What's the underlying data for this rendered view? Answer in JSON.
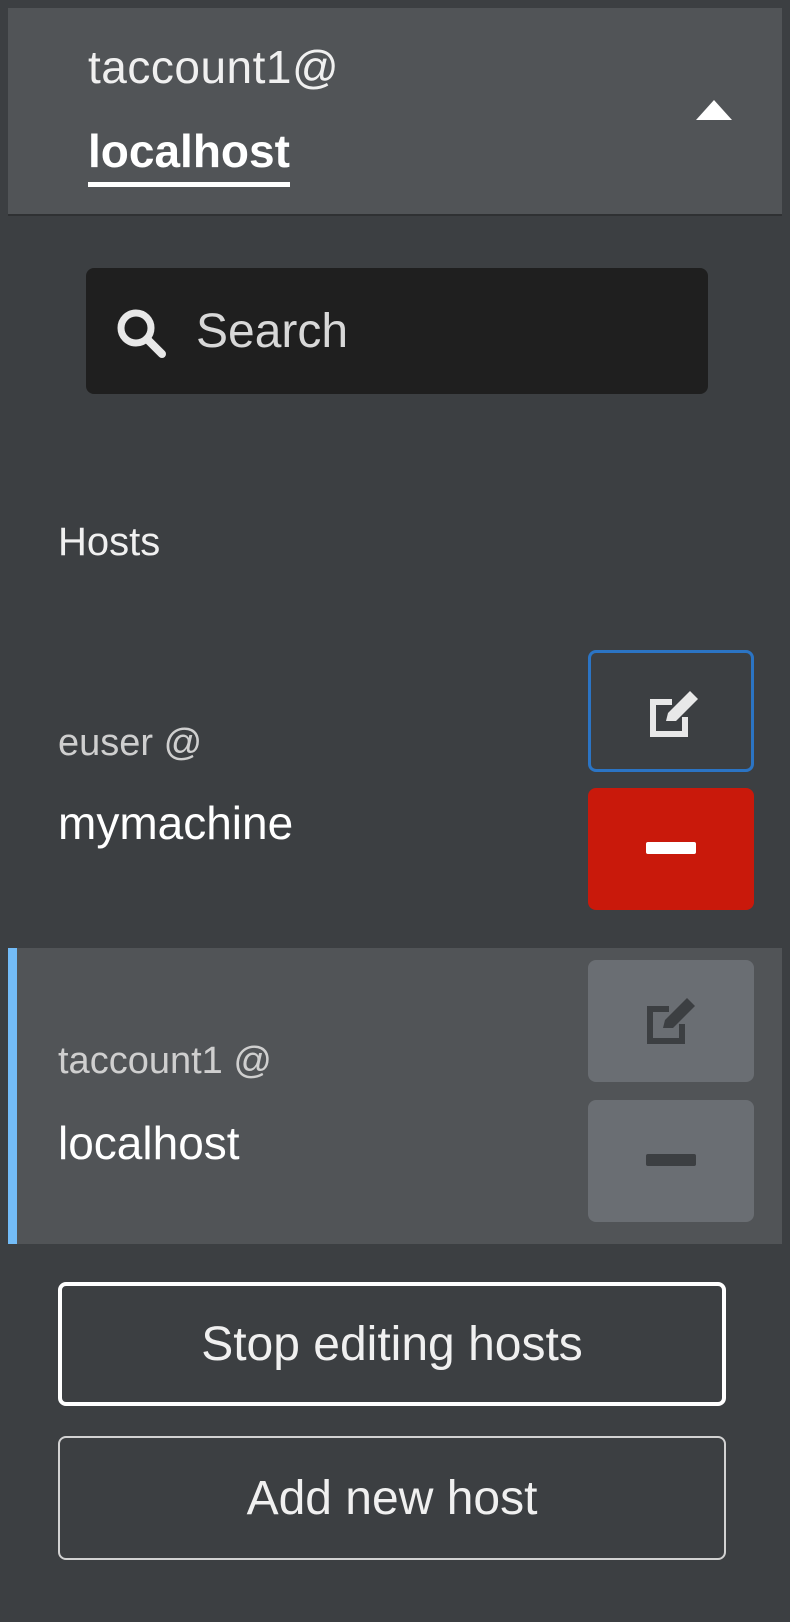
{
  "header": {
    "user": "taccount1@",
    "host": "localhost"
  },
  "search": {
    "placeholder": "Search",
    "value": ""
  },
  "hosts": {
    "title": "Hosts",
    "items": [
      {
        "user": "euser @",
        "host": "mymachine",
        "selected": false
      },
      {
        "user": "taccount1 @",
        "host": "localhost",
        "selected": true
      }
    ]
  },
  "actions": {
    "stop_editing_label": "Stop editing hosts",
    "add_host_label": "Add new host"
  },
  "icons": {
    "header_toggle": "caret-up-icon",
    "search": "search-icon",
    "edit": "edit-icon",
    "remove": "minus-icon"
  },
  "colors": {
    "danger": "#c9190b",
    "focus_border": "#2b74c4",
    "selected_accent": "#73bcf7"
  }
}
